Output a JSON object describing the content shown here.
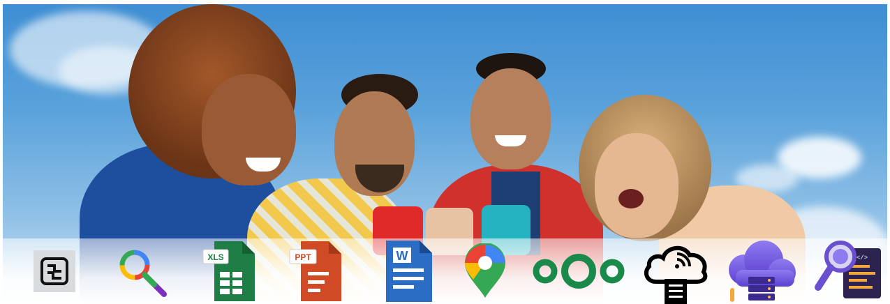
{
  "hero": {
    "sky_color": "#4a95d6",
    "accent_colors": {
      "jacket_blue": "#1e4f9e",
      "jacket_red": "#d0312d",
      "shirt_yellow": "#f2c94c"
    }
  },
  "dock": {
    "icons": [
      {
        "name": "app-grid-icon"
      },
      {
        "name": "search-icon"
      },
      {
        "name": "spreadsheet-icon",
        "text": "XLS"
      },
      {
        "name": "presentation-icon",
        "text": "PPT"
      },
      {
        "name": "document-icon",
        "text": "W"
      },
      {
        "name": "maps-icon"
      },
      {
        "name": "nextcloud-icon"
      },
      {
        "name": "cloud-upload-icon"
      },
      {
        "name": "cloud-server-icon"
      },
      {
        "name": "code-inspect-icon"
      }
    ]
  }
}
